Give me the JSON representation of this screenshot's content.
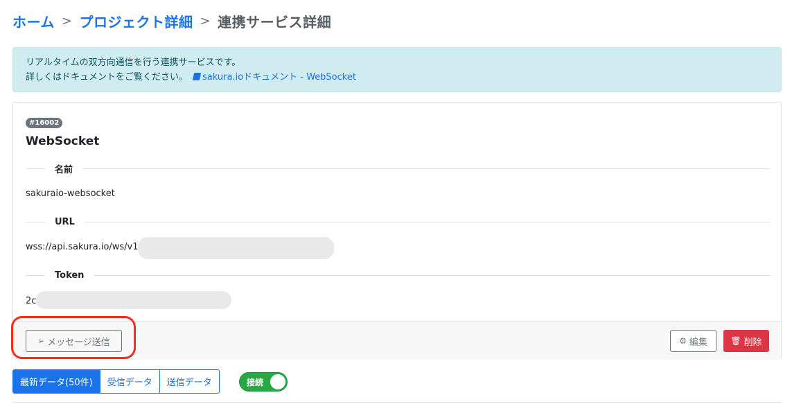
{
  "breadcrumb": {
    "home": "ホーム",
    "project": "プロジェクト詳細",
    "current": "連携サービス詳細",
    "separator": ">"
  },
  "alert": {
    "line1": "リアルタイムの双方向通信を行う連携サービスです。",
    "line2": "詳しくはドキュメントをご覧ください。",
    "doc_link": "sakura.ioドキュメント - WebSocket"
  },
  "service": {
    "id_badge": "#16002",
    "title": "WebSocket",
    "fields": [
      {
        "label": "名前",
        "value": "sakuraio-websocket"
      },
      {
        "label": "URL",
        "value": "wss://api.sakura.io/ws/v1/"
      },
      {
        "label": "Token",
        "value": "2c"
      }
    ]
  },
  "footer": {
    "send_message": "メッセージ送信",
    "edit": "編集",
    "delete": "削除"
  },
  "tabs": [
    "最新データ(50件)",
    "受信データ",
    "送信データ"
  ],
  "connection_toggle": {
    "label": "接続",
    "on": true
  },
  "colors": {
    "primary": "#1a73e8",
    "danger": "#dc3545",
    "success": "#28a745",
    "info_bg": "#d1ecf1",
    "highlight": "#ff2a1a"
  }
}
